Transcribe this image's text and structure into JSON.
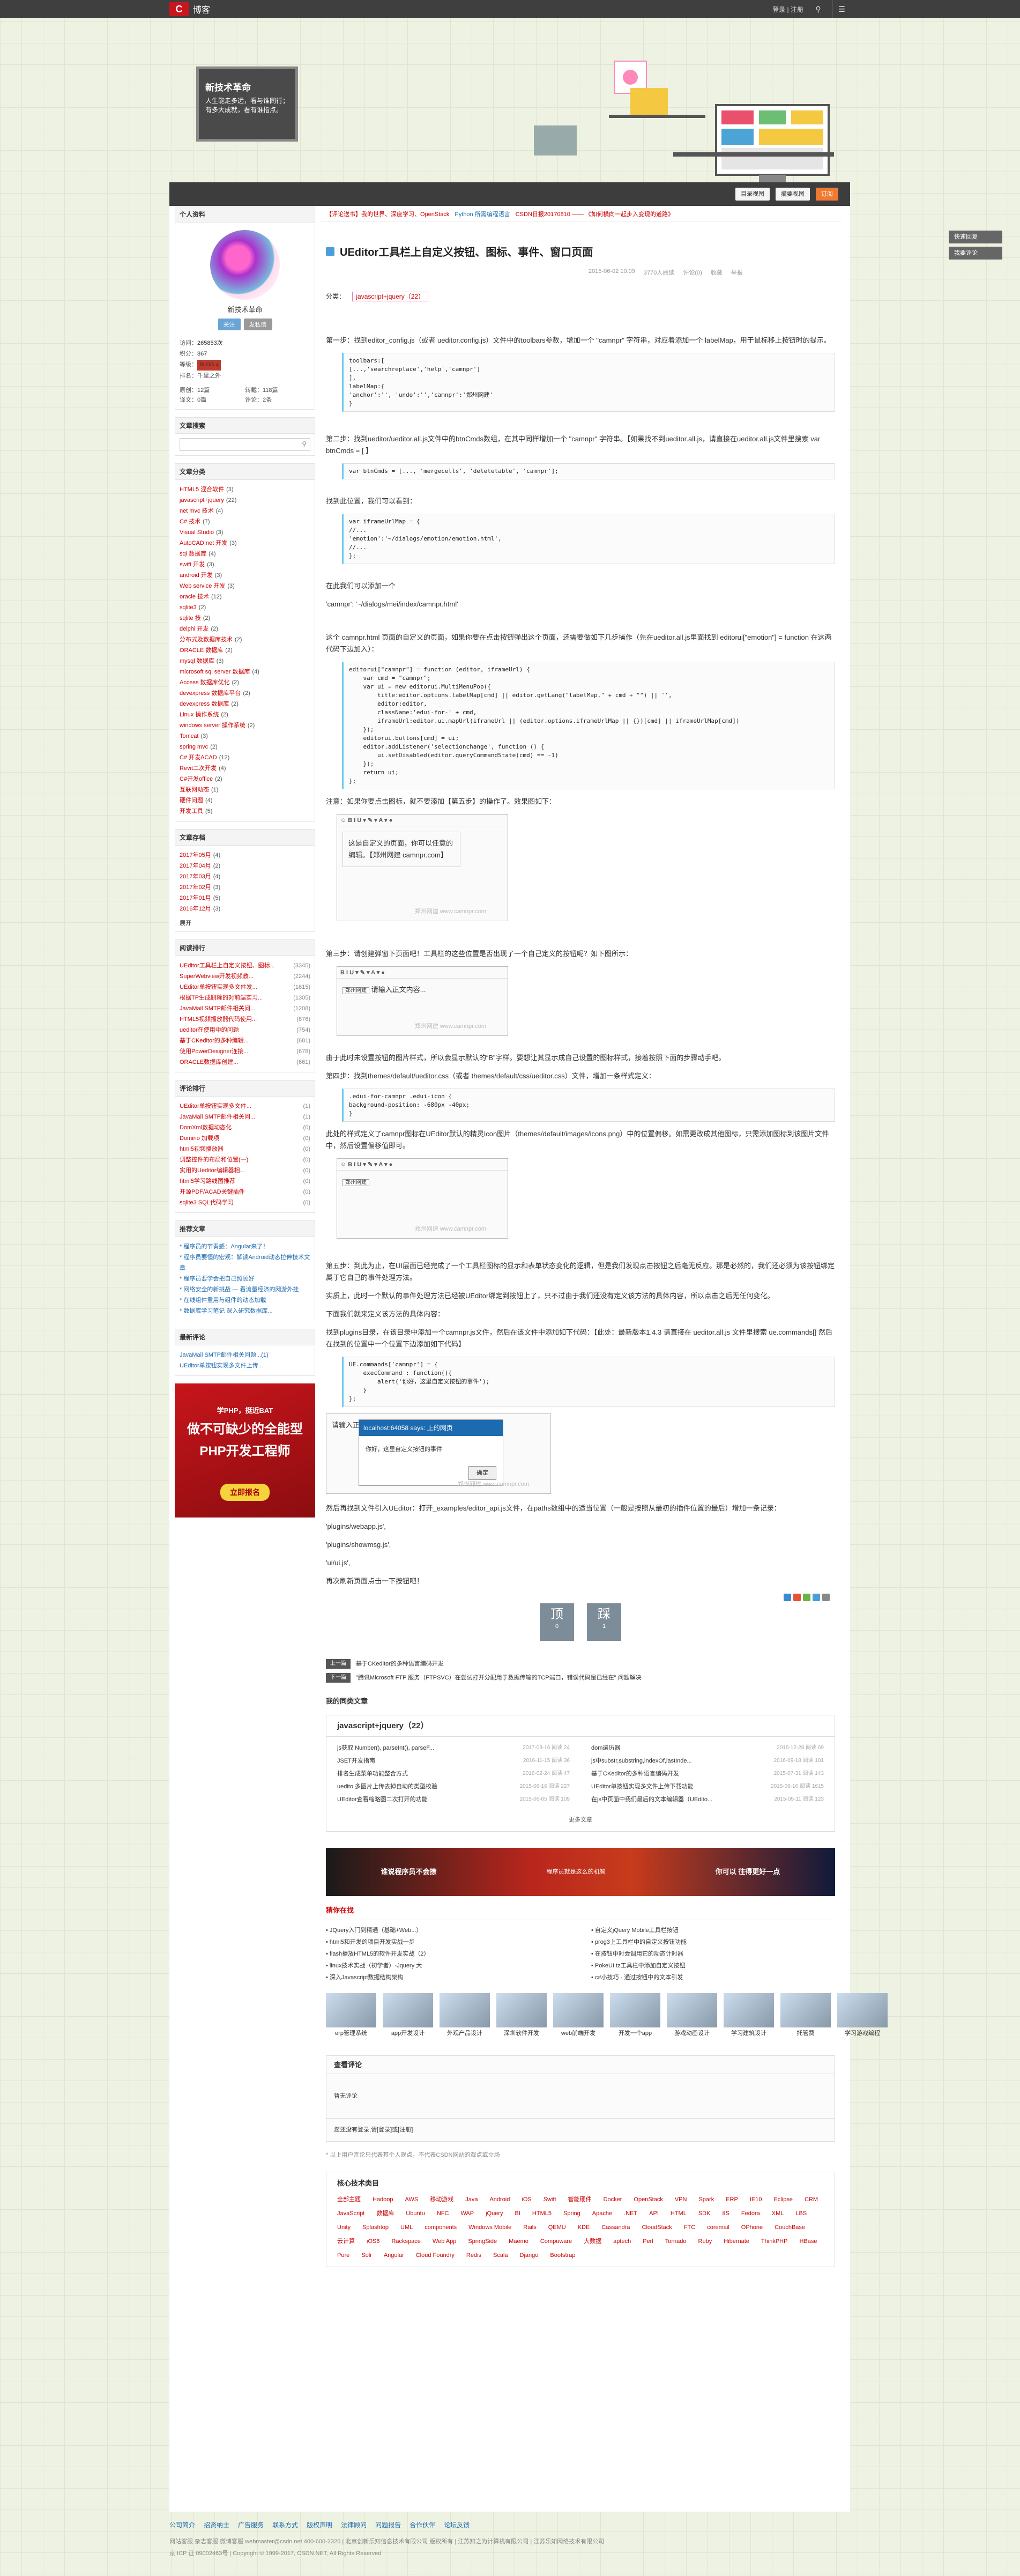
{
  "topbar": {
    "logo_mark": "C",
    "logo_text": "博客",
    "login_text": "登录 | 注册",
    "icons": [
      "search-icon",
      "menu-icon"
    ]
  },
  "banner": {
    "title": "新技术革命",
    "subtitle": "人生能走多远，看与谁同行；有多大成就，看有谁指点。"
  },
  "navbar": {
    "btn1": "目录视图",
    "btn2": "摘要视图",
    "btn3": "订阅"
  },
  "notice": {
    "n1": "【评论送书】我的世界、深度学习、OpenStack",
    "n2": "Python 所需编程语言",
    "n3": "CSDN日报20170810 —— 《如何横向一起步入变现的道路》"
  },
  "sidebar": {
    "profile": {
      "header": "个人资料",
      "name": "新技术革命",
      "follow": "关注",
      "message": "发私信",
      "stats": [
        {
          "k": "访问：",
          "v": "265853次"
        },
        {
          "k": "积分：",
          "v": "867"
        },
        {
          "k": "等级：",
          "v": "BLOG 4"
        },
        {
          "k": "排名：",
          "v": "千里之外"
        }
      ],
      "grid": [
        {
          "k": "原创：",
          "v": "12篇"
        },
        {
          "k": "转载：",
          "v": "118篇"
        },
        {
          "k": "译文：",
          "v": "0篇"
        },
        {
          "k": "评论：",
          "v": "2条"
        }
      ]
    },
    "search": {
      "header": "文章搜索"
    },
    "categories": {
      "header": "文章分类",
      "items": [
        {
          "n": "HTML5 混合软件",
          "c": "(3)"
        },
        {
          "n": "javascript+jquery",
          "c": "(22)"
        },
        {
          "n": "net mvc 技术",
          "c": "(4)"
        },
        {
          "n": "C# 技术",
          "c": "(7)"
        },
        {
          "n": "Visual Studio",
          "c": "(3)"
        },
        {
          "n": "AutoCAD.net 开发",
          "c": "(3)"
        },
        {
          "n": "sql 数据库",
          "c": "(4)"
        },
        {
          "n": "swift 开发",
          "c": "(3)"
        },
        {
          "n": "android 开发",
          "c": "(3)"
        },
        {
          "n": "Web service 开发",
          "c": "(3)"
        },
        {
          "n": "oracle 技术",
          "c": "(12)"
        },
        {
          "n": "sqlite3",
          "c": "(2)"
        },
        {
          "n": "sqlite 技",
          "c": "(2)"
        },
        {
          "n": "delphi 开发",
          "c": "(2)"
        },
        {
          "n": "分布式及数据库技术",
          "c": "(2)"
        },
        {
          "n": "ORACLE 数据库",
          "c": "(2)"
        },
        {
          "n": "mysql 数据库",
          "c": "(3)"
        },
        {
          "n": "microsoft sql server 数据库",
          "c": "(4)"
        },
        {
          "n": "Access 数据库优化",
          "c": "(2)"
        },
        {
          "n": "devexpress 数据库平台",
          "c": "(2)"
        },
        {
          "n": "devexpress 数据库",
          "c": "(2)"
        },
        {
          "n": "Linux 操作系统",
          "c": "(2)"
        },
        {
          "n": "windows server 操作系统",
          "c": "(2)"
        },
        {
          "n": "Tomcat",
          "c": "(3)"
        },
        {
          "n": "spring mvc",
          "c": "(2)"
        },
        {
          "n": "C# 开发ACAD",
          "c": "(12)"
        },
        {
          "n": "Revit二次开发",
          "c": "(4)"
        },
        {
          "n": "C#开发office",
          "c": "(2)"
        },
        {
          "n": "互联网动态",
          "c": "(1)"
        },
        {
          "n": "硬件问题",
          "c": "(4)"
        },
        {
          "n": "开发工具",
          "c": "(5)"
        }
      ]
    },
    "archive": {
      "header": "文章存档",
      "items": [
        {
          "n": "2017年05月",
          "c": "(4)"
        },
        {
          "n": "2017年04月",
          "c": "(2)"
        },
        {
          "n": "2017年03月",
          "c": "(4)"
        },
        {
          "n": "2017年02月",
          "c": "(3)"
        },
        {
          "n": "2017年01月",
          "c": "(5)"
        },
        {
          "n": "2016年12月",
          "c": "(3)"
        }
      ],
      "more": "展开"
    },
    "reads": {
      "header": "阅读排行",
      "items": [
        {
          "n": "UEditor工具栏上自定义按钮、图标...",
          "c": "(3345)"
        },
        {
          "n": "SuperWebview开发视频教...",
          "c": "(2244)"
        },
        {
          "n": "UEditor单按钮实现多文件发...",
          "c": "(1615)"
        },
        {
          "n": "根据TP生成删除的对前端实习...",
          "c": "(1305)"
        },
        {
          "n": "JavaMail SMTP邮件相关问...",
          "c": "(1208)"
        },
        {
          "n": "HTML5视频播放器代码使用...",
          "c": "(876)"
        },
        {
          "n": "ueditor在使用中的问题",
          "c": "(754)"
        },
        {
          "n": "基于CKeditor的多种编辑...",
          "c": "(681)"
        },
        {
          "n": "使用PowerDesigner连接...",
          "c": "(678)"
        },
        {
          "n": "ORACLE数据库创建...",
          "c": "(661)"
        }
      ]
    },
    "comments_rank": {
      "header": "评论排行",
      "items": [
        {
          "n": "UEditor单按钮实现多文件...",
          "c": "(1)"
        },
        {
          "n": "JavaMail SMTP邮件相关问...",
          "c": "(1)"
        },
        {
          "n": "DomXml数据动态化",
          "c": "(0)"
        },
        {
          "n": "Domino 加载项",
          "c": "(0)"
        },
        {
          "n": "html5视频播放器",
          "c": "(0)"
        },
        {
          "n": "调整控件的布局和位置(一)",
          "c": "(0)"
        },
        {
          "n": "实用的Ueditor编辑器相...",
          "c": "(0)"
        },
        {
          "n": "html5学习路线图推荐",
          "c": "(0)"
        },
        {
          "n": "开源PDF/ACAD关键插件",
          "c": "(0)"
        },
        {
          "n": "sqlite3 SQL代码学习",
          "c": "(0)"
        }
      ]
    },
    "recommend": {
      "header": "推荐文章",
      "items": [
        "* 程序员的节奏感：Angular来了！",
        "* 程序员要懂的宏观：解读Android动态拉伸技术文章",
        "* 程序员要学会把自己照顾好",
        "* 网络安全的新挑战 — 看流量经济的网游外挂",
        "* 在线组件重用与组件的动态加载",
        "* 数据库学习笔记 深入研究数据库..."
      ]
    },
    "latest_comments": {
      "header": "最新评论",
      "items": [
        "JavaMail SMTP邮件相关问题...(1)",
        "UEditor单按钮实现多文件上传..."
      ]
    },
    "ad": {
      "line1": "学PHP，挺近BAT",
      "line2": "做不可缺少的全能型",
      "line3": "PHP开发工程师",
      "btn": "立即报名"
    }
  },
  "article": {
    "title": "UEditor工具栏上自定义按钮、图标、事件、窗口页面",
    "date": "2015-06-02 10:09",
    "views": "3770人阅读",
    "comments": "评论(0)",
    "collect": "收藏",
    "report": "举报",
    "cat_label": "分类：",
    "cat": "javascript+jquery（22）",
    "p1": "第一步：找到editor_config.js（或者 ueditor.config.js）文件中的toolbars参数，增加一个 \"camnpr\" 字符串，对应着添加一个 labelMap，用于鼠标移上按钮时的提示。",
    "c1": "toolbars:[\n[...,'searchreplace','help','camnpr']\n],\nlabelMap:{\n'anchor':'', 'undo':'','camnpr':'郑州网建'\n}",
    "p2": "第二步：找到ueditor/ueditor.all.js文件中的btnCmds数组，在其中同样增加一个 \"camnpr\" 字符串。【如果找不到ueditor.all.js，请直接在ueditor.all.js文件里搜索 var btnCmds = [ 】",
    "c2": "var btnCmds = [..., 'mergecells', 'deletetable', 'camnpr'];",
    "p3": "找到此位置，我们可以看到：",
    "c3": "var iframeUrlMap = {\n//...\n'emotion':'~/dialogs/emotion/emotion.html',\n//...\n};",
    "p4": "在此我们可以添加一个",
    "p5": "'camnpr': '~/dialogs/mei/index/camnpr.html'",
    "p6": "这个 camnpr.html 页面的自定义的页面，如果你要在点击按钮弹出这个页面，还需要做如下几步操作（先在ueditor.all.js里面找到 editorui[\"emotion\"] = function 在这两代码下边加入）：",
    "c4": "editorui[\"camnpr\"] = function (editor, iframeUrl) {\n    var cmd = \"camnpr\";\n    var ui = new editorui.MultiMenuPop({\n        title:editor.options.labelMap[cmd] || editor.getLang(\"labelMap.\" + cmd + \"\") || '',\n        editor:editor,\n        className:'edui-for-' + cmd,\n        iframeUrl:editor.ui.mapUrl(iframeUrl || (editor.options.iframeUrlMap || {})[cmd] || iframeUrlMap[cmd])\n    });\n    editorui.buttons[cmd] = ui;\n    editor.addListener('selectionchange', function () {\n        ui.setDisabled(editor.queryCommandState(cmd) == -1)\n    });\n    return ui;\n};",
    "p7": "注意：如果你要点击图标，就不要添加【第五步】的操作了。效果图如下：",
    "shot1": "这是自定义的页面，你可以任意的编辑。【郑州网建 camnpr.com】",
    "watermark": "郑州网建 www.camnpr.com",
    "p8": "第三步：请创建弹窗下页面吧！工具栏的这些位置是否出现了一个自己定义的按钮呢？如下图所示：",
    "shot2_tip": "郑州网建",
    "shot2_text": "请输入正文内容...",
    "p9": "由于此时未设置按钮的图片样式，所以会显示默认的“B”字样。要想让其显示成自己设置的图标样式，接着按照下面的步骤动手吧。",
    "p10": "第四步：找到themes/default/ueditor.css（或者 themes/default/css/ueditor.css）文件，增加一条样式定义：",
    "c5": ".edui-for-camnpr .edui-icon {\nbackground-position: -680px -40px;\n}",
    "p11": "此处的样式定义了camnpr图标在UEditor默认的精灵Icon图片（themes/default/images/icons.png）中的位置偏移。如需更改成其他图标，只需添加图标到该图片文件中，然后设置偏移值即可。",
    "p12": "第五步：到此为止，在UI层面已经完成了一个工具栏图标的显示和表单状态变化的逻辑，但是我们发现点击按钮之后毫无反应。那是必然的，我们还必须为该按钮绑定属于它自己的事件处理方法。",
    "p13": "实质上，此时一个默认的事件处理方法已经被UEditor绑定到按钮上了，只不过由于我们还没有定义该方法的具体内容，所以点击之后无任何变化。",
    "p14": "下面我们就来定义该方法的具体内容：",
    "p15": "找到plugins目录，在该目录中添加一个camnpr.js文件，然后在该文件中添加如下代码：【此处：最新版本1.4.3 请直接在 ueditor.all.js 文件里搜索 ue.commands[] 然后在找到的位置中一个位置下边添加如下代码】",
    "c6": "UE.commands['camnpr'] = {\n    execCommand : function(){\n        alert('你好，这里自定义按钮的事件');\n    }\n};",
    "dialog_title": "localhost:64058 says: 上的网页",
    "dialog_msg": "你好，这里自定义按钮的事件",
    "dialog_ok": "确定",
    "shot3_text": "请输入正文内容...",
    "p16": "然后再找到文件引入UEditor：打开_examples/editor_api.js文件，在paths数组中的适当位置（一般是按照从最初的插件位置的最后）增加一条记录：",
    "p17": "'plugins/webapp.js',",
    "p18": "'plugins/showmsg.js',",
    "p19": "'ui/ui.js',",
    "p20": "再次刷新页面点击一下按钮吧！",
    "vote_up": "顶",
    "vote_up_n": "0",
    "vote_down": "踩",
    "vote_down_n": "1",
    "prev_label": "上一篇",
    "prev": "基于CKeditor的多种语言编码开发",
    "next_label": "下一篇",
    "next": "\"腾讯Microsoft FTP 服务（FTPSVC）在尝试打开分配用于数据传输的TCP端口，错误代码是已经在\" 问题解决",
    "mycat_section": "我的同类文章",
    "mycat_title": "javascript+jquery（22）",
    "mycat": [
      {
        "t": "js获取 Number(), parseInt(), parseF...",
        "d": "2017-03-16  阅读 24"
      },
      {
        "t": "dom遍历器",
        "d": "2016-12-28  阅读 69"
      },
      {
        "t": "JSET开发指南",
        "d": "2016-11-15  阅读 36"
      },
      {
        "t": "js中substr,substring,indexOf,lastInde...",
        "d": "2016-09-18  阅读 101"
      },
      {
        "t": "排名生成菜单功能整合方式",
        "d": "2016-02-24  阅读 47"
      },
      {
        "t": "基于CKeditor的多种语言编码开发",
        "d": "2015-07-31  阅读 143"
      },
      {
        "t": "uedito 多图片上传去掉自动的类型校验",
        "d": "2015-06-16  阅读 227"
      },
      {
        "t": "UEditor单按钮实现多文件上传下载功能",
        "d": "2015-06-16  阅读 1615"
      },
      {
        "t": "UEditor查看缩略图二次打开的功能",
        "d": "2015-06-05  阅读 109"
      },
      {
        "t": "在js中页面中我们最后的文本编辑器（UEdito...",
        "d": "2015-05-11  阅读 123"
      }
    ],
    "more": "更多文章",
    "banner2_left": "谁说程序员不会撩",
    "banner2_right": "你可以\n往得更好一点",
    "banner2_sub": "程序员就是这么的机智",
    "related_title": "猜你在找",
    "related": [
      "• JQuery入门到精通（基础+Web...）",
      "• 自定义jQuery Mobile工具栏按钮",
      "• html5和开发的项目开发实战一步",
      "• prog3上工具栏中的自定义按钮功能",
      "• flash播放HTML5的软件开发实战（2）",
      "• 在按钮中时会调用它的动态计时器",
      "• linux技术实战（初学者）-Jquery 大",
      "• PokeUI.tz工具栏中添加自定义按钮",
      "• 深入Javascript数据结构架构",
      "• c#小技巧 - 通过按钮中的文本引发"
    ],
    "thumbs": [
      "erp管理系统",
      "app开发设计",
      "外观产品设计",
      "深圳软件开发",
      "web前端开发",
      "开发一个app",
      "游戏动画设计",
      "学习建筑设计",
      "托管费",
      "学习游戏编程"
    ],
    "comment_head": "查看评论",
    "comment_empty": "暂无评论",
    "comment_login": "您还没有登录,请[登录]或[注册]",
    "comment_note": "* 以上用户言论只代表其个人观点，不代表CSDN网站的观点或立场",
    "tags_head": "核心技术类目",
    "tags": [
      "全部主题",
      "Hadoop",
      "AWS",
      "移动游戏",
      "Java",
      "Android",
      "iOS",
      "Swift",
      "智能硬件",
      "Docker",
      "OpenStack",
      "VPN",
      "Spark",
      "ERP",
      "IE10",
      "Eclipse",
      "CRM",
      "JavaScript",
      "数据库",
      "Ubuntu",
      "NFC",
      "WAP",
      "jQuery",
      "BI",
      "HTML5",
      "Spring",
      "Apache",
      ".NET",
      "API",
      "HTML",
      "SDK",
      "IIS",
      "Fedora",
      "XML",
      "LBS",
      "Unity",
      "Splashtop",
      "UML",
      "components",
      "Windows Mobile",
      "Rails",
      "QEMU",
      "KDE",
      "Cassandra",
      "CloudStack",
      "FTC",
      "coremail",
      "OPhone",
      "CouchBase",
      "云计算",
      "iOS6",
      "Rackspace",
      "Web App",
      "SpringSide",
      "Maemo",
      "Compuware",
      "大数据",
      "aptech",
      "Perl",
      "Tornado",
      "Ruby",
      "Hibernate",
      "ThinkPHP",
      "HBase",
      "Pure",
      "Solr",
      "Angular",
      "Cloud Foundry",
      "Redis",
      "Scala",
      "Django",
      "Bootstrap"
    ]
  },
  "float": {
    "b1": "快速回复",
    "b2": "我要评论"
  },
  "footer": {
    "links": [
      "公司简介",
      "招贤纳士",
      "广告服务",
      "联系方式",
      "版权声明",
      "法律顾问",
      "问题报告",
      "合作伙伴",
      "论坛反馈"
    ],
    "row2": "网站客服  杂志客服  微博客服  webmaster@csdn.net  400-600-2320 | 北京创新乐知信息技术有限公司 版权所有 | 江苏知之为计算机有限公司 | 江苏乐知网络技术有限公司",
    "row3": "京 ICP 证 09002463号 | Copyright © 1999-2017, CSDN.NET, All Rights Reserved"
  }
}
